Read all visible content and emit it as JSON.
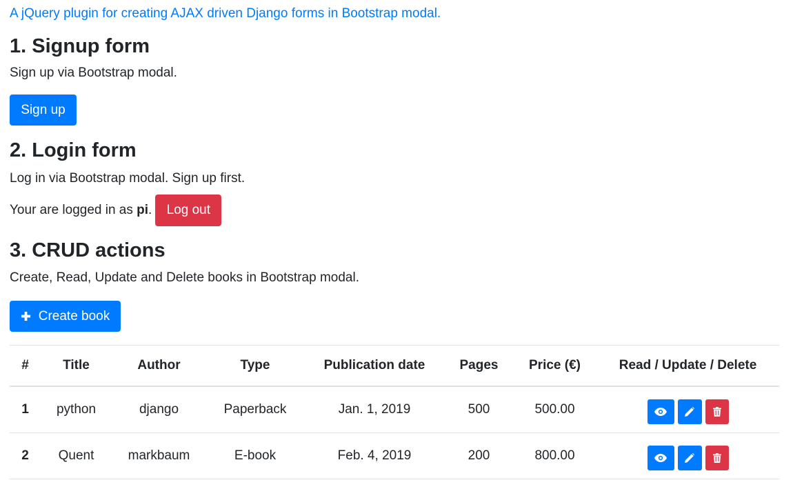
{
  "intro": {
    "link_text": "A jQuery plugin for creating AJAX driven Django forms in Bootstrap modal."
  },
  "signup": {
    "heading": "1. Signup form",
    "description": "Sign up via Bootstrap modal.",
    "button_label": "Sign up"
  },
  "login": {
    "heading": "2. Login form",
    "description": "Log in via Bootstrap modal. Sign up first.",
    "status_prefix": "Your are logged in as ",
    "username": "pi",
    "status_suffix": ".",
    "logout_label": "Log out"
  },
  "crud": {
    "heading": "3. CRUD actions",
    "description": "Create, Read, Update and Delete books in Bootstrap modal.",
    "create_label": "Create book"
  },
  "table": {
    "headers": [
      "#",
      "Title",
      "Author",
      "Type",
      "Publication date",
      "Pages",
      "Price (€)",
      "Read / Update / Delete"
    ],
    "rows": [
      {
        "num": "1",
        "title": "python",
        "author": "django",
        "type": "Paperback",
        "date": "Jan. 1, 2019",
        "pages": "500",
        "price": "500.00"
      },
      {
        "num": "2",
        "title": "Quent",
        "author": "markbaum",
        "type": "E-book",
        "date": "Feb. 4, 2019",
        "pages": "200",
        "price": "800.00"
      }
    ]
  },
  "colors": {
    "primary": "#007bff",
    "danger": "#dc3545",
    "text": "#212529"
  },
  "icons": {
    "create": "plus-icon",
    "read": "eye-icon",
    "update": "pencil-icon",
    "delete": "trash-icon"
  }
}
